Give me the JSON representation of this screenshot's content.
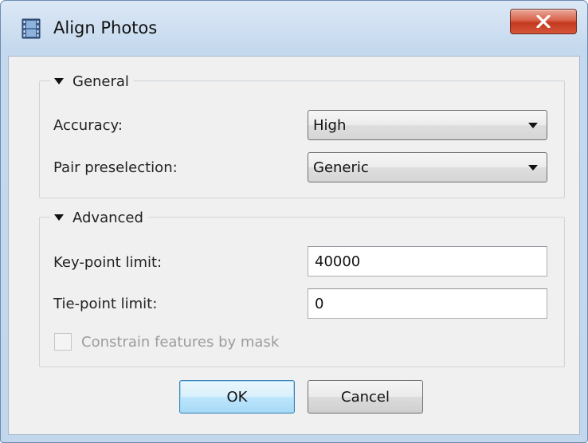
{
  "window": {
    "title": "Align Photos",
    "icon": "film-strip-icon",
    "close_icon": "close-icon"
  },
  "general": {
    "header": "General",
    "accuracy_label": "Accuracy:",
    "accuracy_value": "High",
    "pair_label": "Pair preselection:",
    "pair_value": "Generic"
  },
  "advanced": {
    "header": "Advanced",
    "keypoint_label": "Key-point limit:",
    "keypoint_value": "40000",
    "tiepoint_label": "Tie-point limit:",
    "tiepoint_value": "0",
    "mask_label": "Constrain features by mask",
    "mask_checked": false,
    "mask_enabled": false
  },
  "buttons": {
    "ok": "OK",
    "cancel": "Cancel"
  },
  "colors": {
    "close_button": "#c3391f",
    "default_button_border": "#3c7fb1",
    "disabled_text": "#9c9c9c"
  }
}
